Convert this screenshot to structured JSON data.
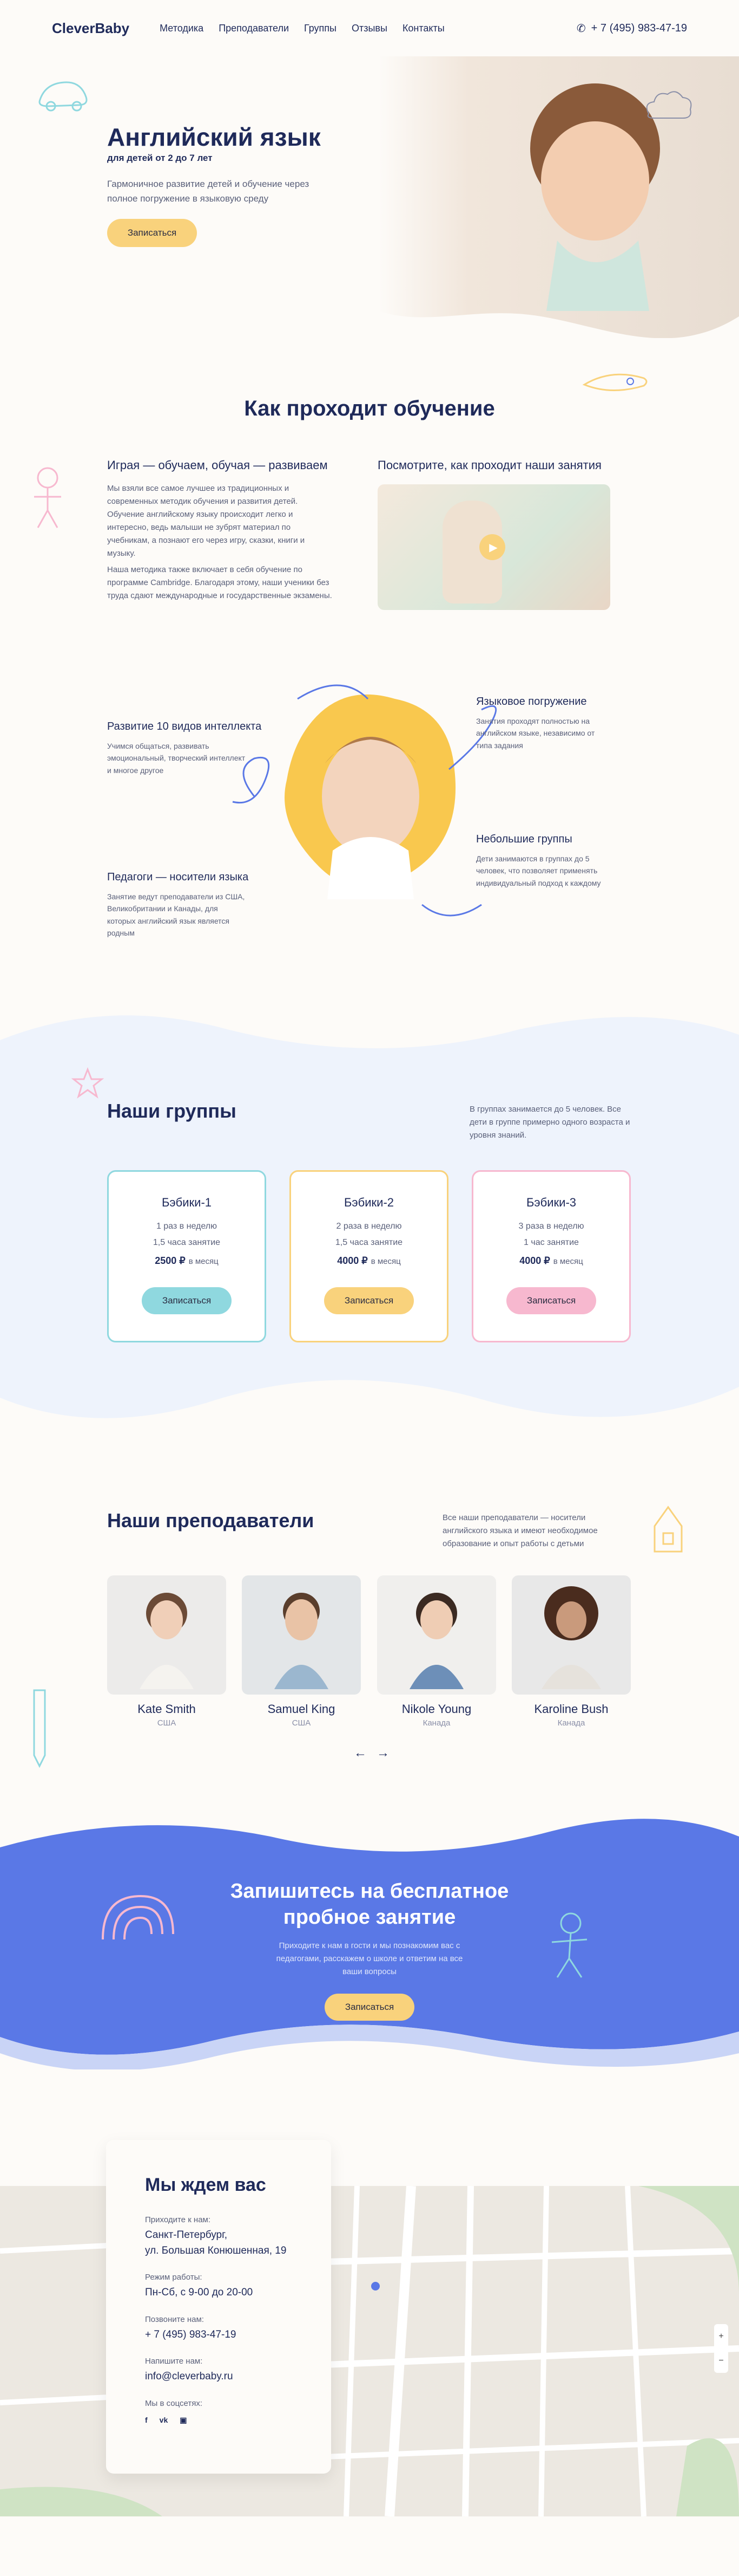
{
  "nav": {
    "logo": "CleverBaby",
    "items": [
      "Методика",
      "Преподаватели",
      "Группы",
      "Отзывы",
      "Контакты"
    ],
    "phone": "+ 7 (495) 983-47-19"
  },
  "hero": {
    "title": "Английский язык",
    "subtitle": "для детей от 2 до 7 лет",
    "text": "Гармоничное развитие детей и обучение через полное погружение в языковую среду",
    "cta": "Записаться"
  },
  "learning": {
    "title": "Как проходит обучение",
    "col1_title": "Играя — обучаем, обучая — развиваем",
    "col1_p1": "Мы взяли все самое лучшее из традиционных и современных методик обучения и развития детей. Обучение английскому языку происходит легко и интересно, ведь малыши не зубрят материал по учебникам, а познают его через игру, сказки, книги и музыку.",
    "col1_p2": "Наша методика также включает в себя обучение по программе Cambridge. Благодаря этому, наши ученики без труда сдают международные и государственные экзамены.",
    "col2_title": "Посмотрите, как проходит наши занятия"
  },
  "features": [
    {
      "title": "Развитие 10 видов интеллекта",
      "text": "Учимся общаться, развивать эмоциональный, творческий интеллект и многое другое"
    },
    {
      "title": "Педагоги — носители языка",
      "text": "Занятие ведут преподаватели из США, Великобритании и Канады, для которых английский язык является родным"
    },
    {
      "title": "Языковое погружение",
      "text": "Занятия проходят полностью на английском языке, независимо от типа задания"
    },
    {
      "title": "Небольшие группы",
      "text": "Дети занимаются в группах до 5 человек, что позволяет применять индивидуальный подход к каждому"
    }
  ],
  "groups": {
    "title": "Наши группы",
    "note": "В группах занимается до 5 человек. Все дети в группе примерно одного возраста и уровня знаний.",
    "cards": [
      {
        "name": "Бэбики-1",
        "freq": "1 раз в неделю",
        "dur": "1,5 часа занятие",
        "price": "2500 ₽",
        "per": "в месяц",
        "cta": "Записаться"
      },
      {
        "name": "Бэбики-2",
        "freq": "2 раза в неделю",
        "dur": "1,5 часа занятие",
        "price": "4000 ₽",
        "per": "в месяц",
        "cta": "Записаться"
      },
      {
        "name": "Бэбики-3",
        "freq": "3 раза в неделю",
        "dur": "1 час занятие",
        "price": "4000 ₽",
        "per": "в месяц",
        "cta": "Записаться"
      }
    ]
  },
  "teachers": {
    "title": "Наши преподаватели",
    "note": "Все наши преподаватели — носители английского языка и имеют необходимое образование и опыт работы с детьми",
    "list": [
      {
        "name": "Kate Smith",
        "country": "США"
      },
      {
        "name": "Samuel King",
        "country": "США"
      },
      {
        "name": "Nikole Young",
        "country": "Канада"
      },
      {
        "name": "Karoline Bush",
        "country": "Канада"
      }
    ],
    "prev": "←",
    "next": "→"
  },
  "trial": {
    "title_l1": "Запишитесь на бесплатное",
    "title_l2": "пробное занятие",
    "text": "Приходите к нам в гости и мы познакомим вас с педагогами, расскажем о школе и ответим на все ваши вопросы",
    "cta": "Записаться"
  },
  "contacts": {
    "title": "Мы ждем вас",
    "address_label": "Приходите к нам:",
    "address_l1": "Санкт-Петербург,",
    "address_l2": "ул. Большая Конюшенная, 19",
    "hours_label": "Режим работы:",
    "hours": "Пн-Сб, с 9-00 до 20-00",
    "phone_label": "Позвоните нам:",
    "phone": "+ 7 (495) 983-47-19",
    "email_label": "Напишите нам:",
    "email": "info@cleverbaby.ru",
    "social_label": "Мы в соцсетях:"
  },
  "colors": {
    "navy": "#1f2a5a",
    "yellow": "#f9d27c",
    "teal": "#8fd8df",
    "pink": "#f7b8cf",
    "blue": "#5a78e6",
    "lightblue": "#eef3fc"
  }
}
